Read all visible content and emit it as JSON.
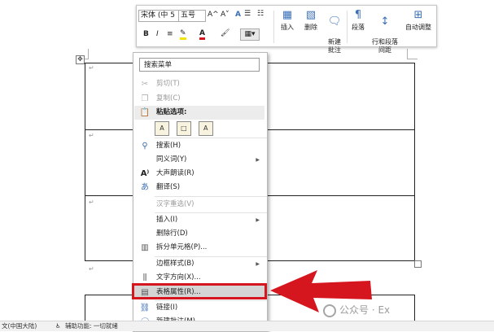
{
  "colors": {
    "highlight_box": "#d6161e",
    "arrow": "#d6161e",
    "icon_blue": "#3a6db4",
    "disabled_text": "#9a9a9a"
  },
  "document": {
    "table_handle_icon": "move-icon",
    "paragraph_mark": "↵"
  },
  "mini_toolbar": {
    "font_name": "宋体 (中 5",
    "font_size": "五号",
    "font_grow_icon": "A^",
    "font_shrink_icon": "A˅",
    "style_icon": "A",
    "bold": "B",
    "italic": "I",
    "insert_label": "插入",
    "delete_label": "删除",
    "new_comment_label": "新建\n批注",
    "paragraph_label": "段落",
    "row_col_spacing_label": "行和段落\n间距",
    "autofit_label": "自动调整"
  },
  "context_menu": {
    "search_placeholder": "搜索菜单",
    "items": [
      {
        "label": "剪切(T)",
        "icon": "scissors-icon",
        "disabled": true
      },
      {
        "label": "复制(C)",
        "icon": "copy-icon",
        "disabled": true
      },
      {
        "label": "粘贴选项:",
        "icon": "paste-icon",
        "header": true
      },
      {
        "label": "搜索(H)",
        "icon": "search-icon"
      },
      {
        "label": "同义词(Y)",
        "icon": "",
        "submenu": true
      },
      {
        "label": "大声朗读(R)",
        "icon": "read-aloud-icon"
      },
      {
        "label": "翻译(S)",
        "icon": "translate-icon"
      },
      {
        "label": "汉字重选(V)",
        "icon": "",
        "disabled": true
      },
      {
        "label": "插入(I)",
        "icon": "",
        "submenu": true
      },
      {
        "label": "删除行(D)",
        "icon": ""
      },
      {
        "label": "拆分单元格(P)...",
        "icon": "split-cells-icon"
      },
      {
        "label": "边框样式(B)",
        "icon": "",
        "submenu": true
      },
      {
        "label": "文字方向(X)...",
        "icon": "text-direction-icon"
      },
      {
        "label": "表格属性(R)...",
        "icon": "table-properties-icon",
        "highlighted": true
      },
      {
        "label": "链接(I)",
        "icon": "link-icon"
      },
      {
        "label": "新建批注(M)",
        "icon": "new-comment-icon"
      }
    ],
    "paste_options": [
      "A",
      "□",
      "A"
    ]
  },
  "status_bar": {
    "language": "文(中国大陆)",
    "accessibility": "辅助功能: 一切就绪"
  },
  "watermark": {
    "text": "公众号 · Ex"
  }
}
